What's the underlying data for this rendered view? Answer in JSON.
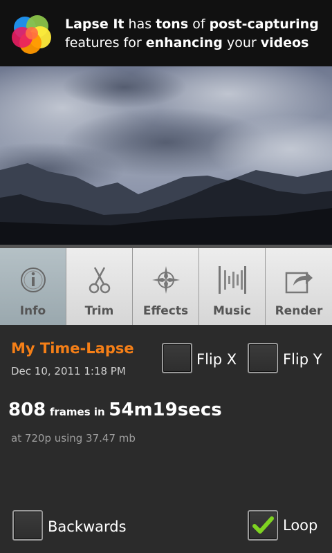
{
  "banner": {
    "parts": [
      {
        "text": "Lapse It",
        "bold": true
      },
      {
        "text": " has ",
        "bold": false
      },
      {
        "text": "tons",
        "bold": true
      },
      {
        "text": " of ",
        "bold": false
      },
      {
        "text": "post-capturing",
        "bold": true
      },
      {
        "text": " features",
        "bold": false
      },
      {
        "text": " for ",
        "bold": false
      },
      {
        "text": "enhancing",
        "bold": true
      },
      {
        "text": " your ",
        "bold": false
      },
      {
        "text": "videos",
        "bold": true
      }
    ]
  },
  "tabs": [
    {
      "label": "Info",
      "icon": "info-icon",
      "active": true
    },
    {
      "label": "Trim",
      "icon": "scissors-icon",
      "active": false
    },
    {
      "label": "Effects",
      "icon": "effects-icon",
      "active": false
    },
    {
      "label": "Music",
      "icon": "music-icon",
      "active": false
    },
    {
      "label": "Render",
      "icon": "share-icon",
      "active": false
    }
  ],
  "project": {
    "title": "My Time-Lapse",
    "date": "Dec 10, 2011 1:18 PM",
    "frames": "808",
    "frames_in": "frames in",
    "duration": "54m19secs",
    "details": "at 720p using 37.47 mb"
  },
  "options": {
    "flip_x": {
      "label": "Flip X",
      "checked": false
    },
    "flip_y": {
      "label": "Flip Y",
      "checked": false
    },
    "backwards": {
      "label": "Backwards",
      "checked": false
    },
    "loop": {
      "label": "Loop",
      "checked": true
    }
  },
  "colors": {
    "accent": "#f57f17",
    "check": "#7ed321"
  }
}
